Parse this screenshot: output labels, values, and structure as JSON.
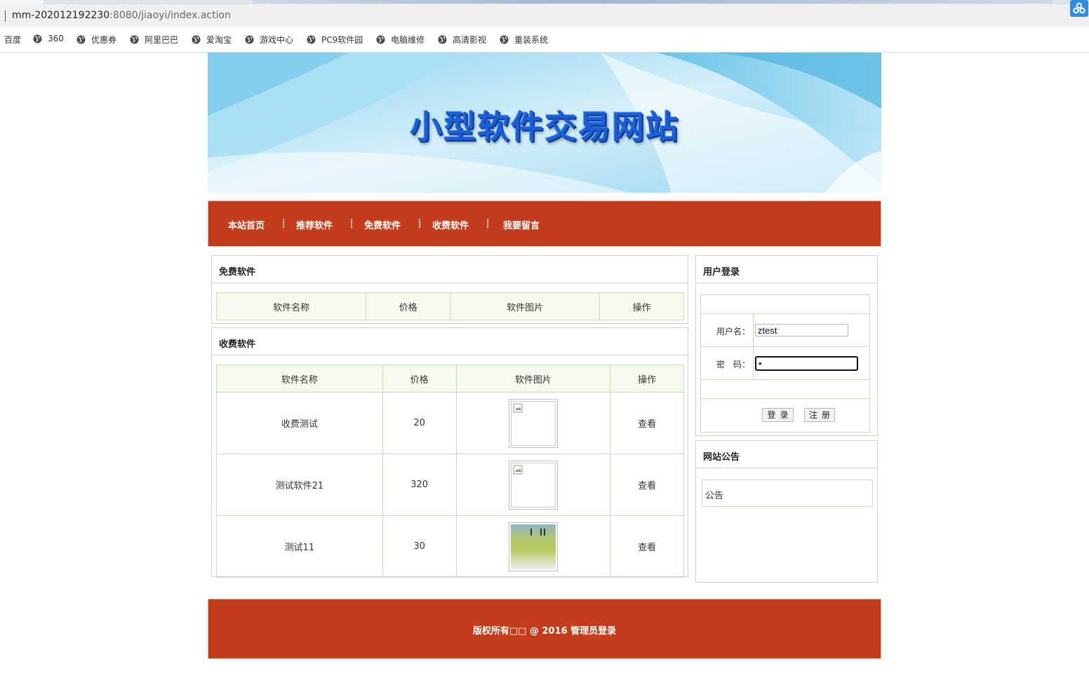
{
  "browser": {
    "url_host": "mm-202012192230",
    "url_rest": ":8080/jiaoyi/index.action",
    "bookmarks": [
      "百度",
      "360",
      "优惠券",
      "阿里巴巴",
      "爱淘宝",
      "游戏中心",
      "PC9软件园",
      "电脑维修",
      "高清影视",
      "重装系统"
    ]
  },
  "site": {
    "banner_title": "小型软件交易网站",
    "nav": [
      "本站首页",
      "推荐软件",
      "免费软件",
      "收费软件",
      "我要留言"
    ],
    "nav_separator": "|"
  },
  "free_software": {
    "title": "免费软件",
    "columns": [
      "软件名称",
      "价格",
      "软件图片",
      "操作"
    ]
  },
  "paid_software": {
    "title": "收费软件",
    "columns": [
      "软件名称",
      "价格",
      "软件图片",
      "操作"
    ],
    "rows": [
      {
        "name": "收费测试",
        "price": "20",
        "image": "broken",
        "action": "查看"
      },
      {
        "name": "测试软件21",
        "price": "320",
        "image": "broken",
        "action": "查看"
      },
      {
        "name": "测试11",
        "price": "30",
        "image": "photo",
        "action": "查看"
      }
    ]
  },
  "login": {
    "title": "用户登录",
    "username_label": "用户名：",
    "username_value": "ztest",
    "password_label": "密　码：",
    "password_value": "•",
    "login_button": "登录",
    "register_button": "注册"
  },
  "notice": {
    "title": "网站公告",
    "content": "公告"
  },
  "footer": {
    "text": "版权所有□□ @ 2016",
    "admin_link": "管理员登录"
  },
  "colors": {
    "nav_bg": "#c33d1c",
    "table_border": "#c8dfb5",
    "header_bg": "#f6f9ee",
    "banner_title": "#1a5fd8"
  }
}
